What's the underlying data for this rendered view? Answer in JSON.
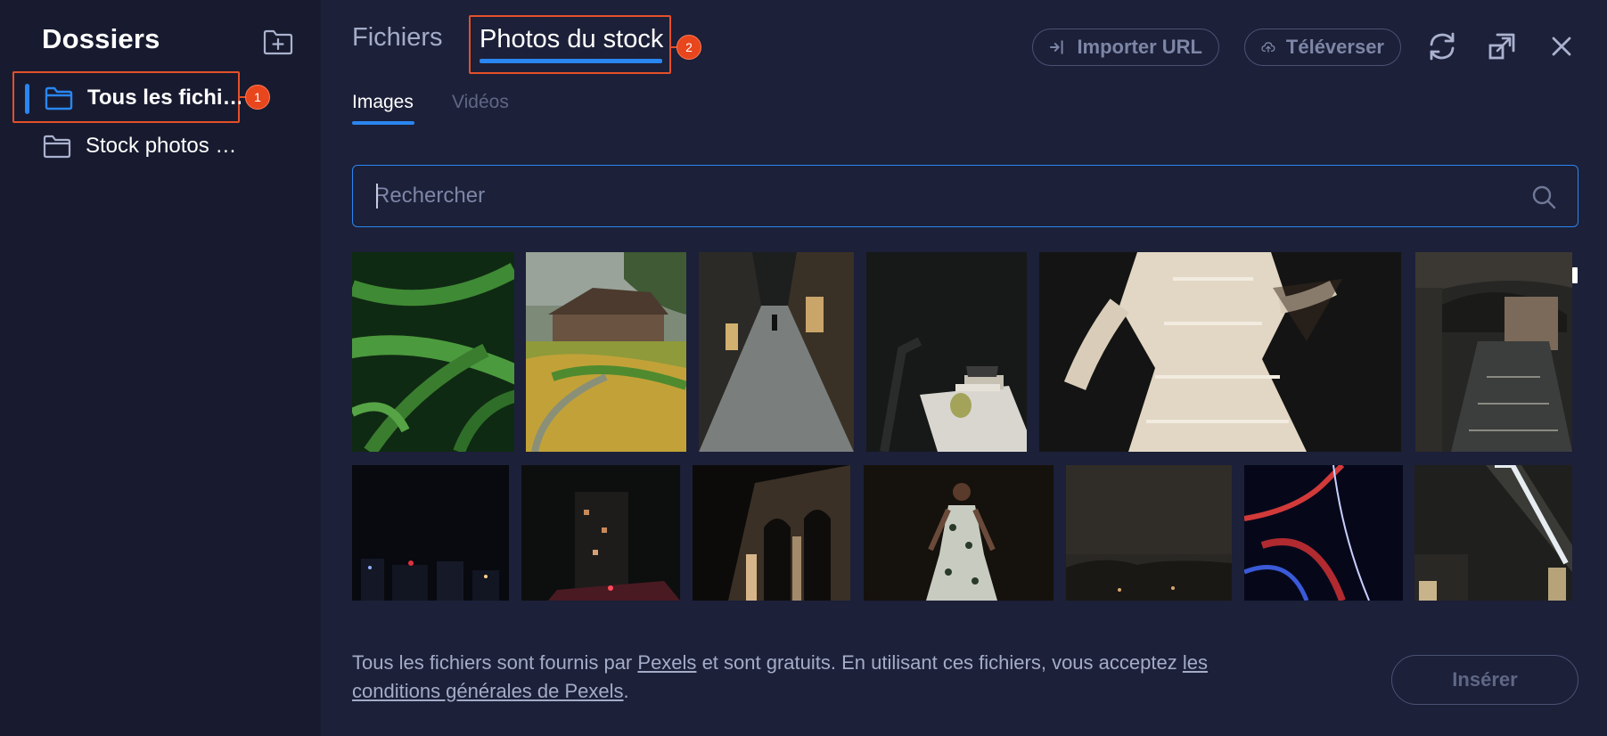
{
  "sidebar": {
    "title": "Dossiers",
    "new_folder_icon": "folder-plus-icon",
    "folders": [
      {
        "label": "Tous les fichi…",
        "active": true,
        "badge": "1"
      },
      {
        "label": "Stock photos …",
        "active": false
      }
    ]
  },
  "header": {
    "tabs": [
      {
        "label": "Fichiers",
        "active": false
      },
      {
        "label": "Photos du stock",
        "active": true,
        "badge": "2"
      }
    ],
    "import_url_label": "Importer URL",
    "upload_label": "Téléverser",
    "icons": [
      "refresh-icon",
      "resize-icon",
      "close-icon"
    ]
  },
  "subtabs": [
    {
      "label": "Images",
      "active": true
    },
    {
      "label": "Vidéos",
      "active": false
    }
  ],
  "search": {
    "placeholder": "Rechercher",
    "value": ""
  },
  "gallery": {
    "row1": [
      "fern-leaves",
      "rice-field-house",
      "narrow-street",
      "telephone-on-table",
      "feathered-dress-dancer",
      "venice-canal"
    ],
    "row2": [
      "city-night-skyline",
      "night-buildings",
      "arched-building-night",
      "woman-in-floral-dress",
      "dark-landscape",
      "light-trails",
      "tunnel-lights"
    ]
  },
  "footer": {
    "text_1": "Tous les fichiers sont fournis par",
    "link_pexels": "Pexels",
    "text_2": "et sont gratuits. En utilisant ces fichiers, vous acceptez",
    "link_terms": "les conditions générales de Pexels",
    "text_3": "."
  },
  "insert_label": "Insérer",
  "colors": {
    "accent": "#2a86f0",
    "highlight": "#e4502a",
    "background": "#1c2038",
    "sidebar": "#181b2f"
  }
}
